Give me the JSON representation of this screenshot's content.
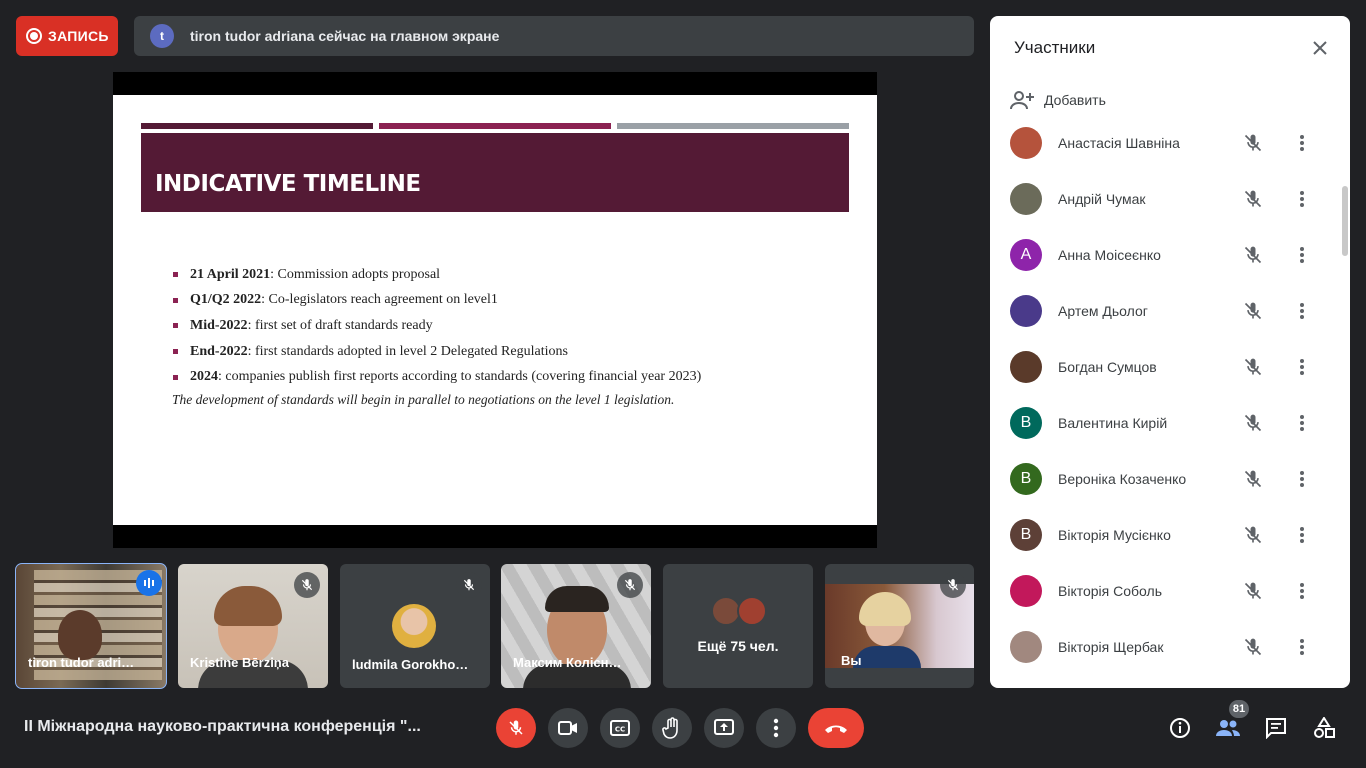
{
  "top": {
    "record_label": "ЗАПИСЬ",
    "presenter_initial": "t",
    "presenting_text": "tiron tudor adriana сейчас на главном экране"
  },
  "slide": {
    "title": "INDICATIVE TIMELINE",
    "bullets": [
      {
        "bold": "21 April 2021",
        "rest": ": Commission adopts proposal"
      },
      {
        "bold": "Q1/Q2 2022",
        "rest": ": Co-legislators reach agreement on level1"
      },
      {
        "bold": "Mid-2022",
        "rest": ": first set of draft standards ready"
      },
      {
        "bold": "End-2022",
        "rest": ": first standards adopted in level 2 Delegated Regulations"
      },
      {
        "bold": "2024",
        "rest": ": companies publish first reports according to standards (covering financial year 2023)"
      }
    ],
    "note": "The development of standards will begin in parallel to negotiations on the level 1 legislation.",
    "colors": {
      "band": "#541a35",
      "bar1": "#541a35",
      "bar2": "#8b2252",
      "bar3": "#9aa0a6"
    }
  },
  "tiles": [
    {
      "label": "tiron tudor adri…",
      "state": "speaking"
    },
    {
      "label": "Kristine Bērziņa",
      "state": "muted"
    },
    {
      "label": "ludmila Gorokho…",
      "state": "muted"
    },
    {
      "label": "Максим Колісн…",
      "state": "muted"
    },
    {
      "label": "Ещё 75 чел.",
      "state": "group"
    },
    {
      "label": "Вы",
      "state": "muted"
    }
  ],
  "panel": {
    "title": "Участники",
    "add_label": "Добавить",
    "participants": [
      {
        "name": "Анастасія Шавніна",
        "initial": "",
        "color": "#b5533c"
      },
      {
        "name": "Андрій Чумак",
        "initial": "",
        "color": "#6b6b5a"
      },
      {
        "name": "Анна Моісеєнко",
        "initial": "А",
        "color": "#8e24aa"
      },
      {
        "name": "Артем Дьолог",
        "initial": "",
        "color": "#4a3a8a"
      },
      {
        "name": "Богдан Сумцов",
        "initial": "",
        "color": "#5a3a2a"
      },
      {
        "name": "Валентина Кирій",
        "initial": "В",
        "color": "#00695c"
      },
      {
        "name": "Вероніка Козаченко",
        "initial": "В",
        "color": "#33691e"
      },
      {
        "name": "Вікторія Мусієнко",
        "initial": "В",
        "color": "#5d4037"
      },
      {
        "name": "Вікторія Соболь",
        "initial": "",
        "color": "#c2185b"
      },
      {
        "name": "Вікторія Щербак",
        "initial": "",
        "color": "#a1887f"
      }
    ]
  },
  "bottom": {
    "meeting_title": "II Міжнародна науково-практична конференція \"...",
    "people_count": "81"
  }
}
